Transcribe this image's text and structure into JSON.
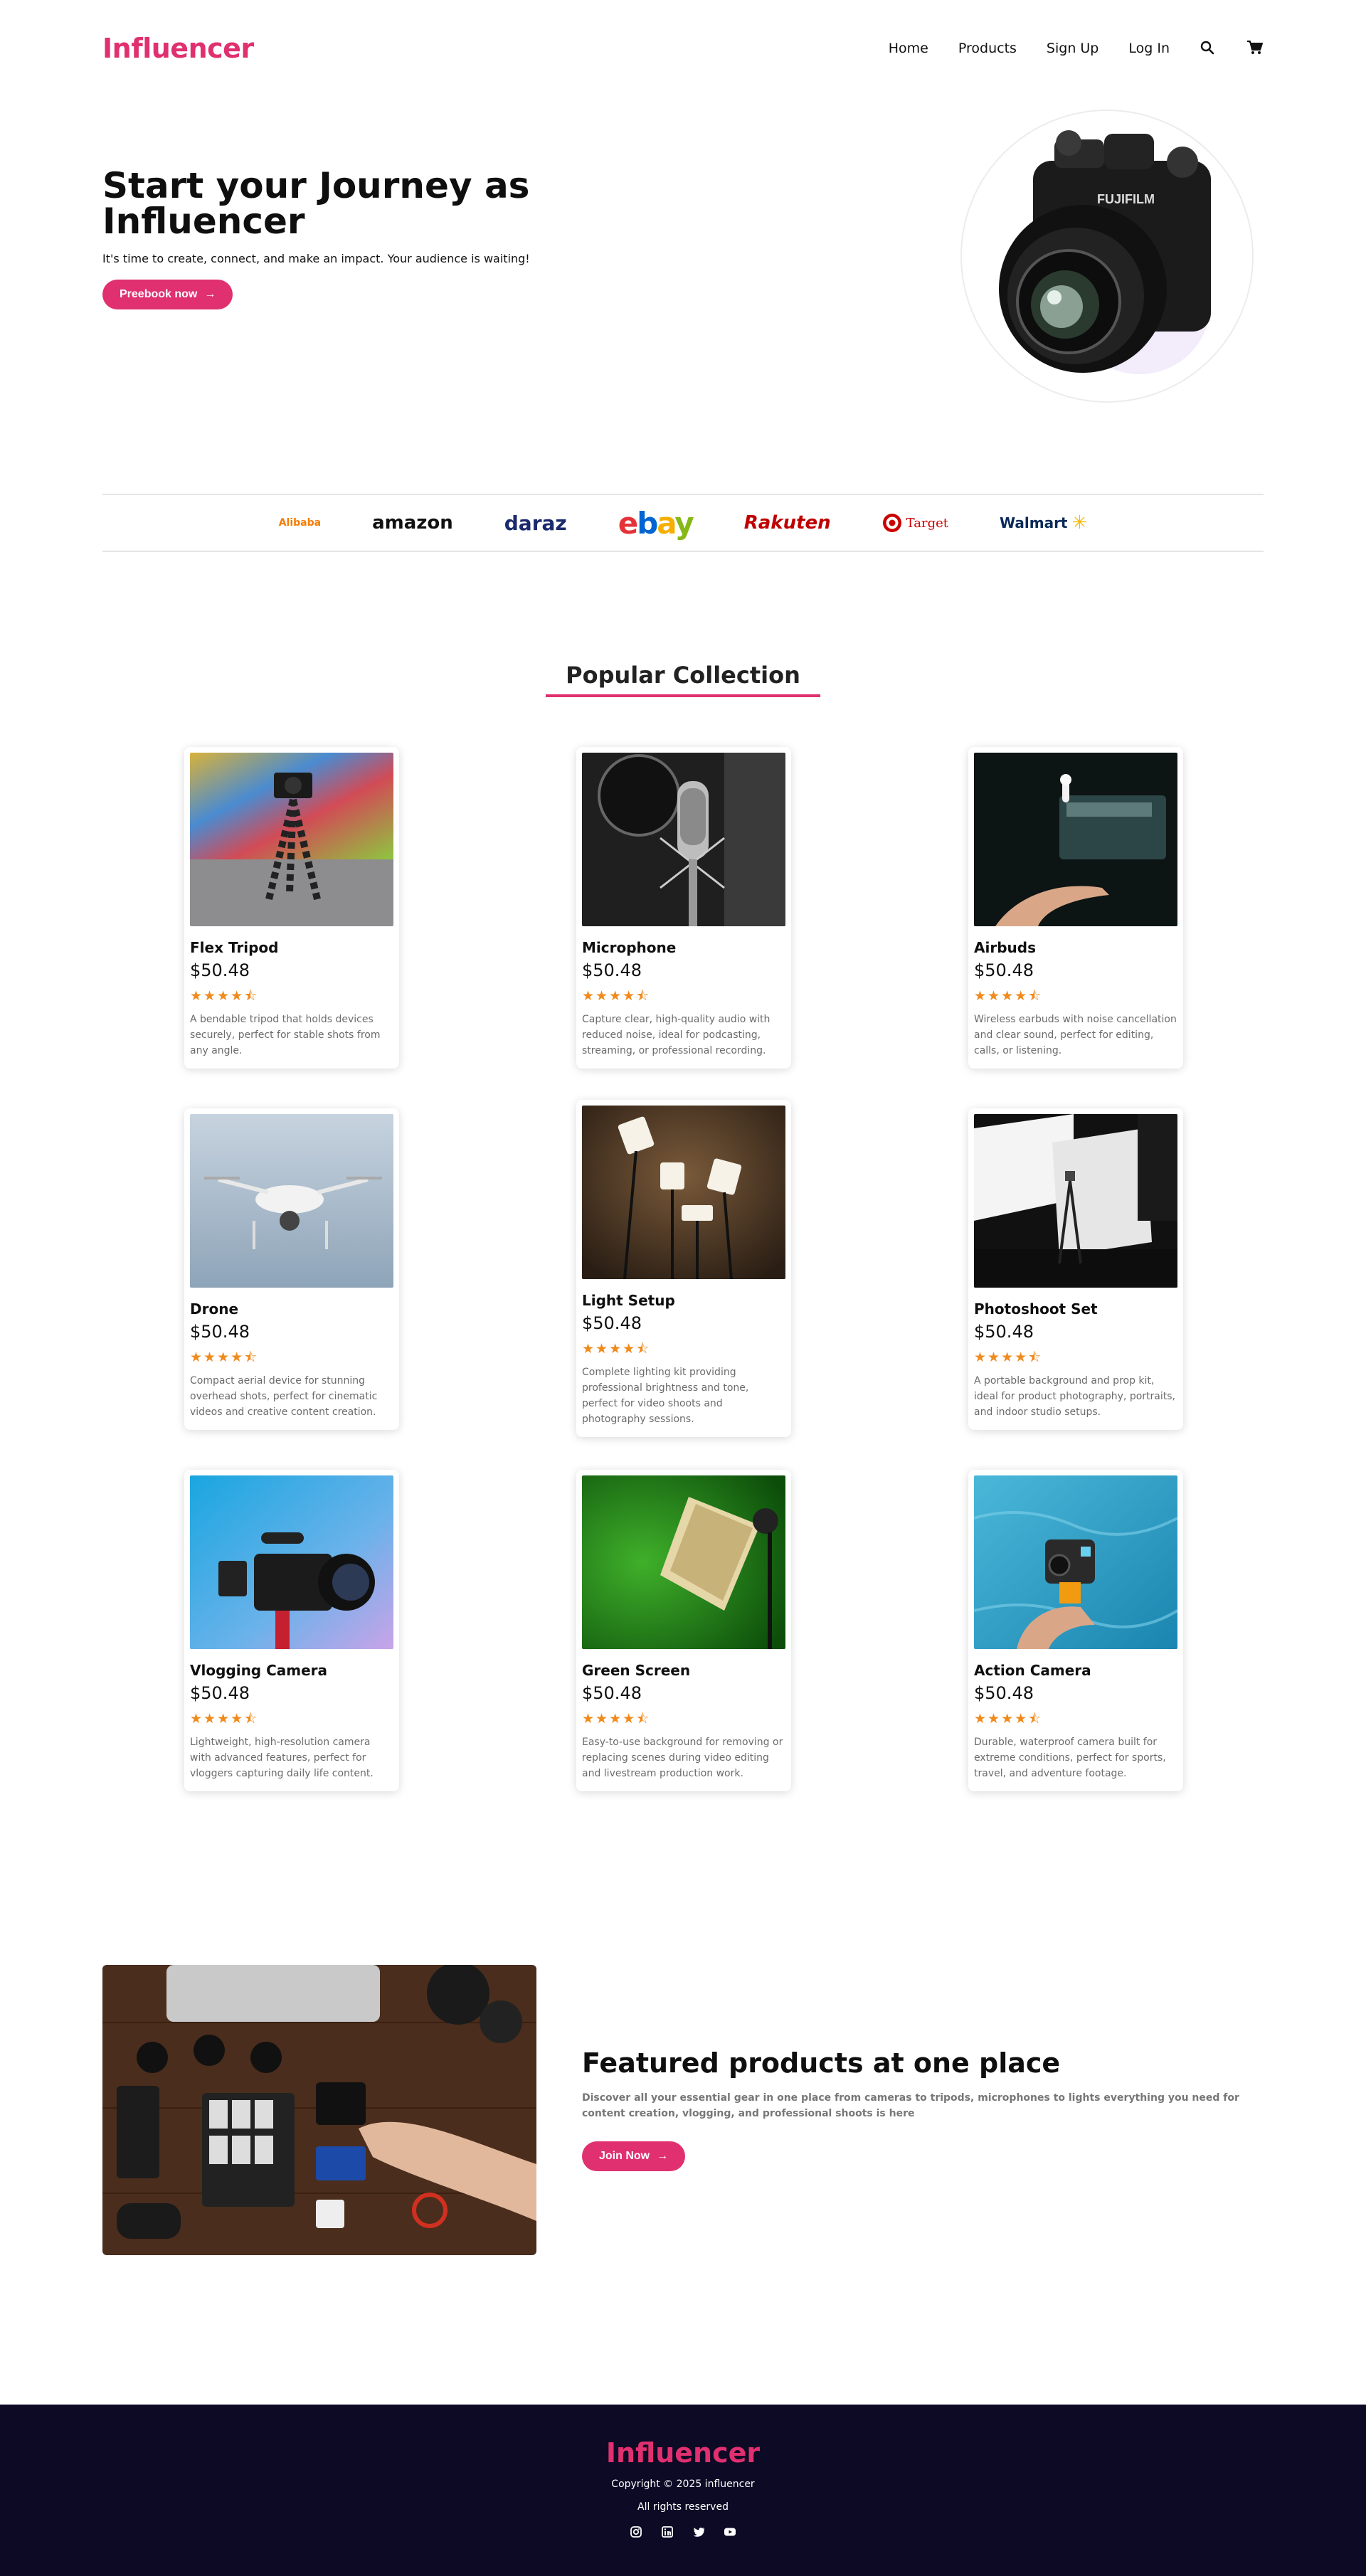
{
  "brand": {
    "logo": "Influencer"
  },
  "nav": {
    "links": [
      "Home",
      "Products",
      "Sign Up",
      "Log In"
    ],
    "icons": [
      "search-icon",
      "cart-icon"
    ]
  },
  "hero": {
    "title": "Start your Journey as Influencer",
    "subtitle": "It's time to create, connect, and make an impact. Your audience is waiting!",
    "cta": "Preebook now"
  },
  "partners": {
    "logos": [
      "Alibaba",
      "amazon",
      "daraz",
      "ebay",
      "Rakuten",
      "Target",
      "Walmart"
    ]
  },
  "collection": {
    "title": "Popular Collection",
    "rating": "★★★★⯪",
    "products": [
      {
        "name": "Flex Tripod",
        "price": "$50.48",
        "rating": 4.5,
        "desc": "A bendable tripod that holds devices securely, perfect for stable shots from any angle."
      },
      {
        "name": "Microphone",
        "price": "$50.48",
        "rating": 4.5,
        "desc": "Capture clear, high-quality audio with reduced noise, ideal for podcasting, streaming, or professional recording."
      },
      {
        "name": "Airbuds",
        "price": "$50.48",
        "rating": 4.5,
        "desc": "Wireless earbuds with noise cancellation and clear sound, perfect for editing, calls, or listening."
      },
      {
        "name": "Drone",
        "price": "$50.48",
        "rating": 4.5,
        "desc": "Compact aerial device for stunning overhead shots, perfect for cinematic videos and creative content creation."
      },
      {
        "name": "Light Setup",
        "price": "$50.48",
        "rating": 4.5,
        "desc": "Complete lighting kit providing professional brightness and tone, perfect for video shoots and photography sessions."
      },
      {
        "name": "Photoshoot Set",
        "price": "$50.48",
        "rating": 4.5,
        "desc": "A portable background and prop kit, ideal for product photography, portraits, and indoor studio setups."
      },
      {
        "name": "Vlogging Camera",
        "price": "$50.48",
        "rating": 4.5,
        "desc": "Lightweight, high-resolution camera with advanced features, perfect for vloggers capturing daily life content."
      },
      {
        "name": "Green Screen",
        "price": "$50.48",
        "rating": 4.5,
        "desc": "Easy-to-use background for removing or replacing scenes during video editing and livestream production work."
      },
      {
        "name": "Action Camera",
        "price": "$50.48",
        "rating": 4.5,
        "desc": "Durable, waterproof camera built for extreme conditions, perfect for sports, travel, and adventure footage."
      }
    ]
  },
  "featured": {
    "title": "Featured products at one place",
    "desc": "Discover all your essential gear in one place from cameras to tripods, microphones to lights everything you need for content creation, vlogging, and professional shoots is here",
    "cta": "Join Now"
  },
  "footer": {
    "logo": "Influencer",
    "copyright": "Copyright © 2025 influencer",
    "rights": "All rights reserved",
    "social": [
      "instagram-icon",
      "linkedin-icon",
      "twitter-icon",
      "youtube-icon"
    ]
  },
  "colors": {
    "accent": "#e0306f",
    "footer_bg": "#0c0a25",
    "star": "#f08a1c"
  }
}
